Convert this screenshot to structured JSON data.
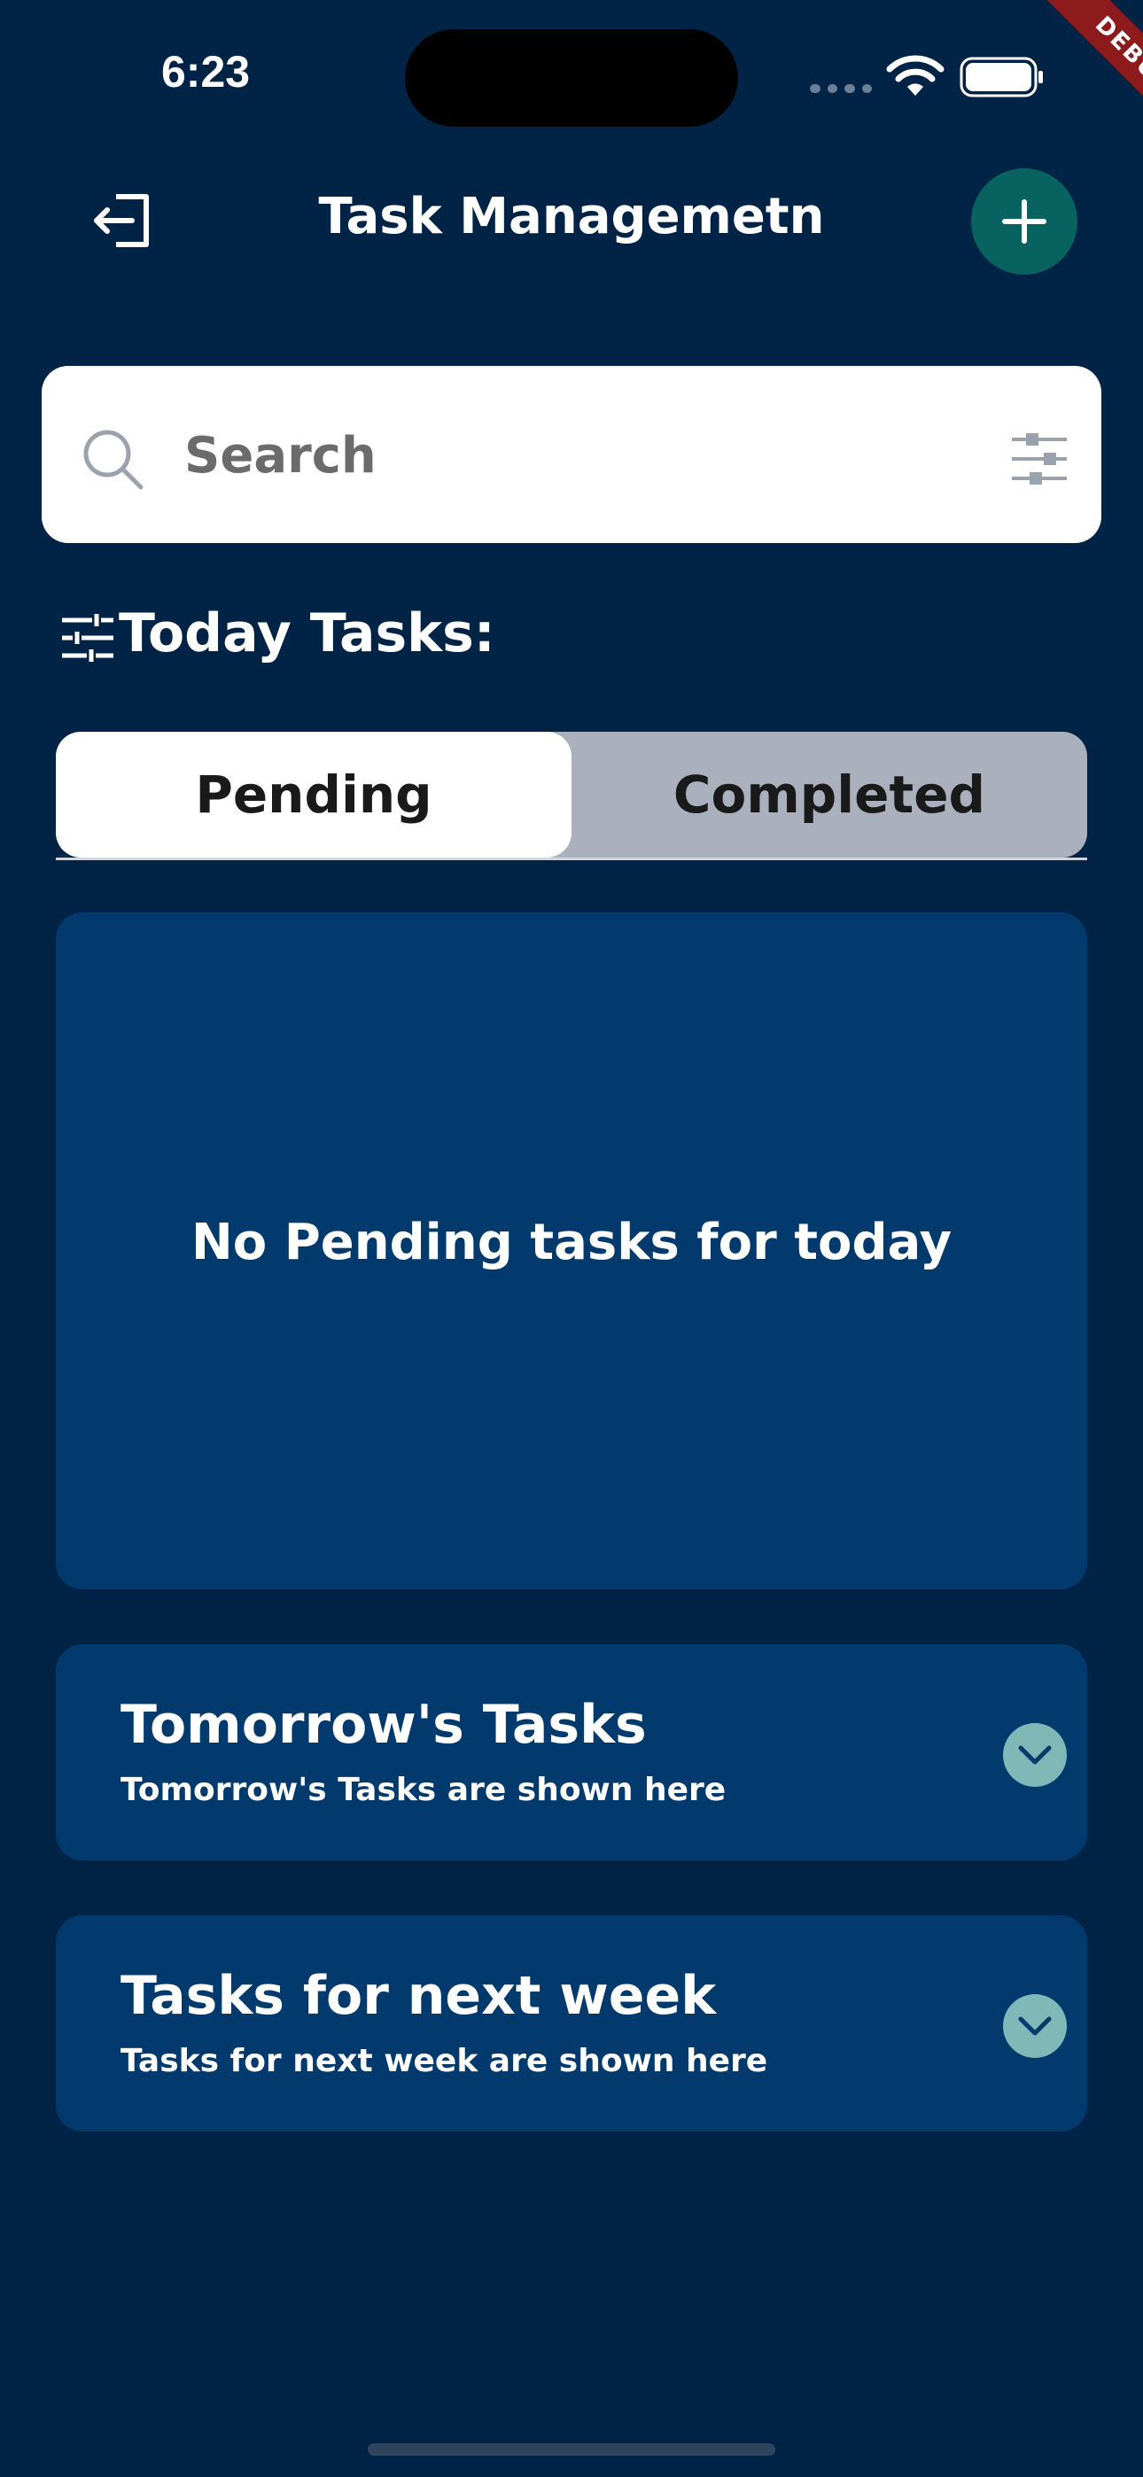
{
  "status_bar": {
    "time": "6:23"
  },
  "debug_ribbon": "DEBUG",
  "header": {
    "title": "Task Managemetn",
    "logout_icon": "logout-icon",
    "add_icon": "plus-icon"
  },
  "search": {
    "placeholder": "Search",
    "value": ""
  },
  "today": {
    "title": "Today Tasks:",
    "tabs": [
      {
        "label": "Pending",
        "selected": true
      },
      {
        "label": "Completed",
        "selected": false
      }
    ],
    "empty_message": "No Pending tasks for today"
  },
  "sections": [
    {
      "title": "Tomorrow's Tasks",
      "subtitle": "Tomorrow's Tasks are shown here"
    },
    {
      "title": "Tasks for next week",
      "subtitle": "Tasks for next week are shown here"
    }
  ],
  "colors": {
    "background": "#012346",
    "card": "#023a6e",
    "accent": "#08625f",
    "chevron": "#7fb8b6",
    "segment_inactive": "#aab1bd"
  }
}
